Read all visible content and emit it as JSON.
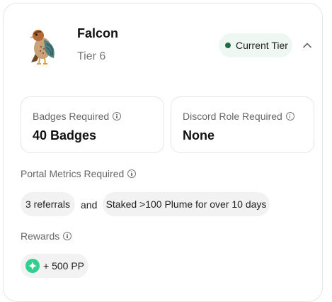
{
  "tier": {
    "name": "Falcon",
    "subtitle": "Tier 6",
    "status_label": "Current Tier",
    "status_color": "#1f6b45",
    "icon": "falcon-icon"
  },
  "requirements": {
    "badges": {
      "label": "Badges Required",
      "value": "40 Badges"
    },
    "discord": {
      "label": "Discord Role Required",
      "value": "None"
    }
  },
  "portal_metrics": {
    "label": "Portal Metrics Required",
    "items": [
      "3 referrals",
      "Staked >100 Plume for over 10 days"
    ],
    "connector": "and"
  },
  "rewards": {
    "label": "Rewards",
    "items": [
      "+ 500 PP"
    ],
    "icon_color": "#2fd08f"
  }
}
